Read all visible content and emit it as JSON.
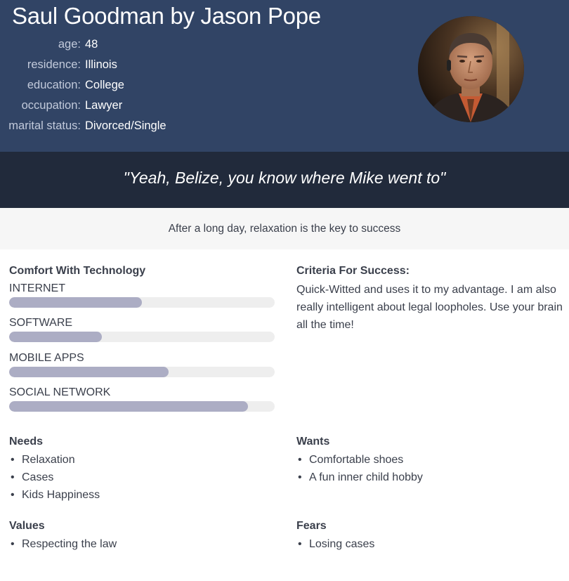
{
  "header": {
    "title": "Saul Goodman by Jason Pope",
    "attributes": [
      {
        "label": "age:",
        "value": "48"
      },
      {
        "label": "residence:",
        "value": "Illinois"
      },
      {
        "label": "education:",
        "value": "College"
      },
      {
        "label": "occupation:",
        "value": "Lawyer"
      },
      {
        "label": "marital status:",
        "value": "Divorced/Single"
      }
    ],
    "avatar_icon": "person-portrait-icon"
  },
  "quote": "\"Yeah, Belize, you know where Mike went to\"",
  "motto": "After a long day, relaxation is the key to success",
  "technology": {
    "title": "Comfort With Technology",
    "skills": [
      {
        "label": "INTERNET",
        "level": 0.5
      },
      {
        "label": "SOFTWARE",
        "level": 0.35
      },
      {
        "label": "MOBILE APPS",
        "level": 0.6
      },
      {
        "label": "SOCIAL NETWORK",
        "level": 0.9
      }
    ]
  },
  "criteria": {
    "title": "Criteria For Success:",
    "text": "Quick-Witted and uses it to my advantage. I am also really intelligent about legal loopholes. Use your brain all the time!"
  },
  "needs": {
    "title": "Needs",
    "items": [
      "Relaxation",
      "Cases",
      "Kids Happiness"
    ]
  },
  "wants": {
    "title": "Wants",
    "items": [
      "Comfortable shoes",
      "A fun inner child hobby"
    ]
  },
  "values": {
    "title": "Values",
    "items": [
      "Respecting the law"
    ]
  },
  "fears": {
    "title": "Fears",
    "items": [
      "Losing cases"
    ]
  },
  "colors": {
    "header_bg": "#314465",
    "quote_bg": "#212a3b",
    "motto_bg": "#f6f6f6",
    "bar_fill": "#acadc4",
    "bar_track": "#eeeeee"
  }
}
